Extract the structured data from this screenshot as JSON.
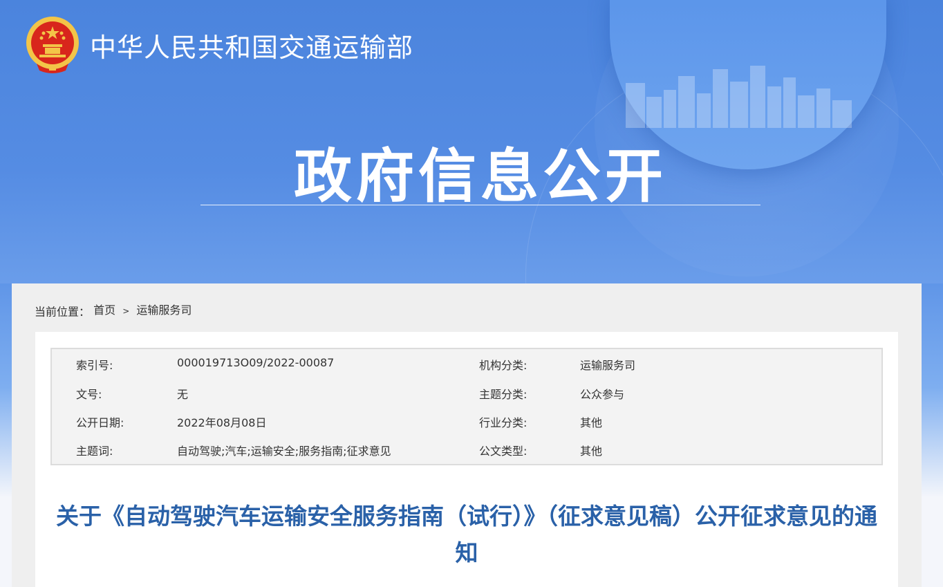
{
  "header": {
    "ministry_name": "中华人民共和国交通运输部",
    "banner_title": "政府信息公开"
  },
  "breadcrumb": {
    "prefix": "当前位置：",
    "items": [
      "首页",
      "运输服务司"
    ],
    "separator": ">"
  },
  "metadata": {
    "rows": [
      {
        "label_left": "索引号:",
        "value_left": "000019713O09/2022-00087",
        "label_right": "机构分类:",
        "value_right": "运输服务司"
      },
      {
        "label_left": "文号:",
        "value_left": "无",
        "label_right": "主题分类:",
        "value_right": "公众参与"
      },
      {
        "label_left": "公开日期:",
        "value_left": "2022年08月08日",
        "label_right": "行业分类:",
        "value_right": "其他"
      },
      {
        "label_left": "主题词:",
        "value_left": "自动驾驶;汽车;运输安全;服务指南;征求意见",
        "label_right": "公文类型:",
        "value_right": "其他"
      }
    ]
  },
  "document": {
    "title": "关于《自动驾驶汽车运输安全服务指南（试行）》（征求意见稿）公开征求意见的通知"
  },
  "colors": {
    "banner_blue": "#4b84dd",
    "title_blue": "#2a61a8",
    "emblem_red": "#d8261c",
    "emblem_gold": "#f3c548"
  },
  "icons": {
    "emblem": "national-emblem-icon"
  }
}
